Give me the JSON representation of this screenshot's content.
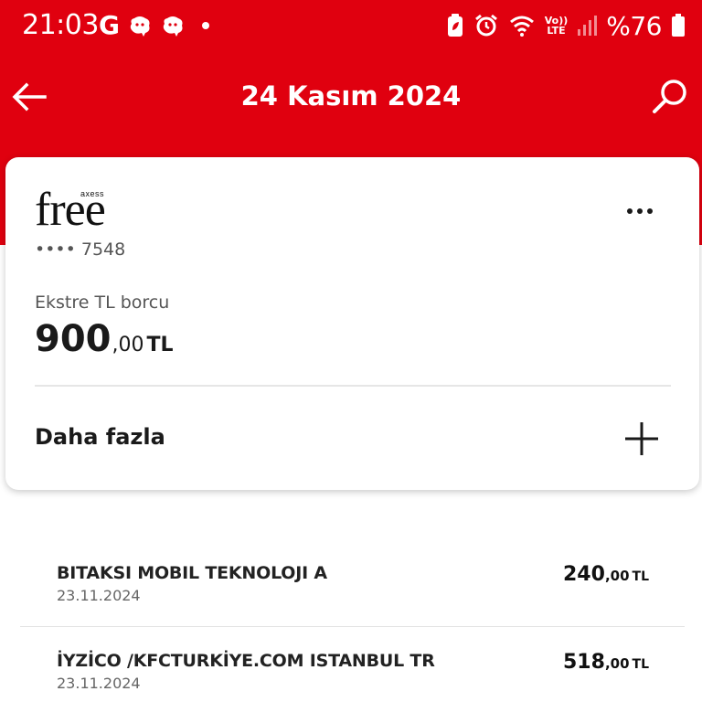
{
  "status_bar": {
    "time": "21:03",
    "g_letter": "G",
    "battery": "%76",
    "volte_top": "Vo))",
    "volte_bottom": "LTE"
  },
  "header": {
    "title": "24 Kasım 2024"
  },
  "card": {
    "logo_brand": "axess",
    "logo_name": "free",
    "number_masked": "•••• 7548",
    "debt_label": "Ekstre TL borcu",
    "debt_integer": "900",
    "debt_decimal": ",00",
    "debt_currency": "TL",
    "more_label": "Daha fazla"
  },
  "transactions": [
    {
      "name": "BITAKSI MOBIL TEKNOLOJI A",
      "date": "23.11.2024",
      "amount_integer": "240",
      "amount_decimal": ",00",
      "currency": "TL"
    },
    {
      "name": "İYZİCO /KFCTURKİYE.COM ISTANBUL TR",
      "date": "23.11.2024",
      "amount_integer": "518",
      "amount_decimal": ",00",
      "currency": "TL"
    }
  ],
  "colors": {
    "brand_red": "#e0000f",
    "text_dark": "#1a1a1a",
    "text_muted": "#555555"
  },
  "icons": {
    "back": "arrow-left-icon",
    "search": "search-icon",
    "more": "more-horizontal-icon",
    "expand": "plus-icon"
  }
}
